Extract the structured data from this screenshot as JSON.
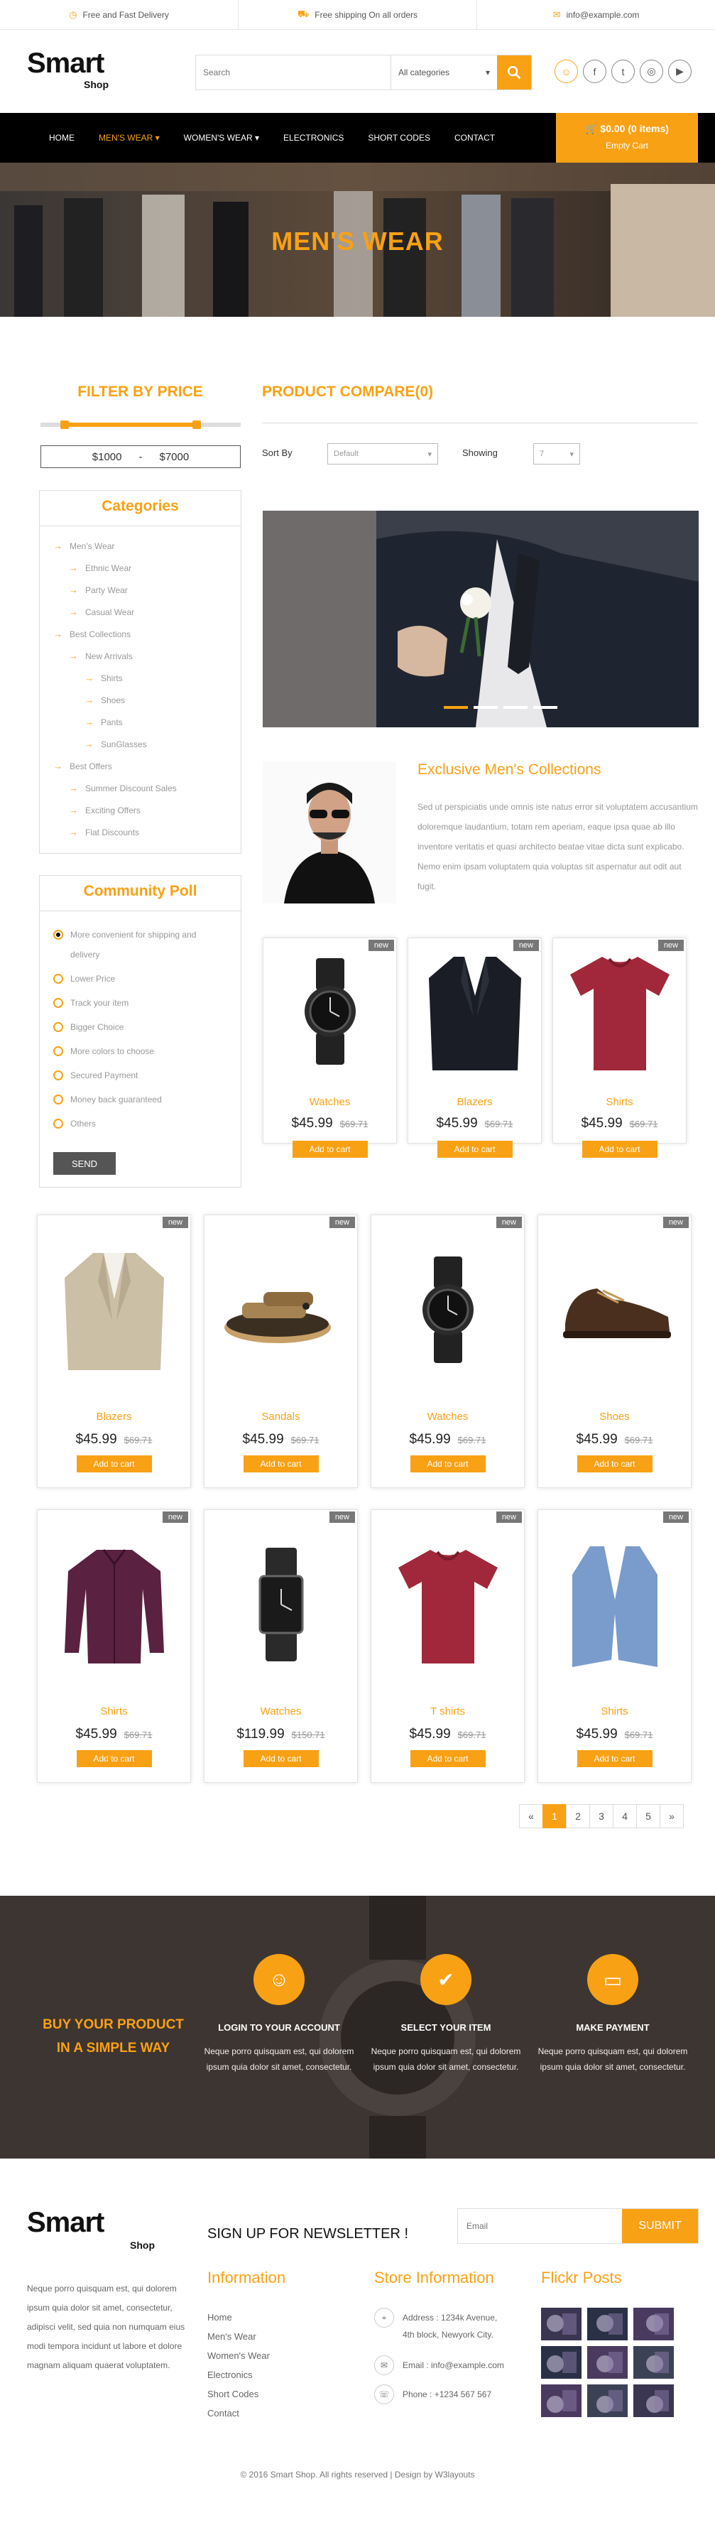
{
  "topbar": {
    "delivery": "Free and Fast Delivery",
    "shipping": "Free shipping On all orders",
    "email": "info@example.com"
  },
  "header": {
    "logo_main": "Smart",
    "logo_sub": "Shop",
    "search_placeholder": "Search",
    "category_select": "All categories"
  },
  "nav": {
    "items": [
      "HOME",
      "MEN'S WEAR",
      "WOMEN'S WEAR",
      "ELECTRONICS",
      "SHORT CODES",
      "CONTACT"
    ],
    "cart_total": "$0.00 (0 items)",
    "cart_label": "Empty Cart"
  },
  "banner": {
    "title": "MEN'S WEAR"
  },
  "filter": {
    "title": "FILTER BY PRICE",
    "min": "$1000",
    "sep": "-",
    "max": "$7000",
    "range_low_fraction": 0.12,
    "range_high_fraction": 0.78
  },
  "categories": {
    "title": "Categories",
    "items": [
      {
        "label": "Men's Wear",
        "level": 0
      },
      {
        "label": "Ethnic Wear",
        "level": 1
      },
      {
        "label": "Party Wear",
        "level": 1
      },
      {
        "label": "Casual Wear",
        "level": 1
      },
      {
        "label": "Best Collections",
        "level": 0
      },
      {
        "label": "New Arrivals",
        "level": 1
      },
      {
        "label": "Shirts",
        "level": 2
      },
      {
        "label": "Shoes",
        "level": 2
      },
      {
        "label": "Pants",
        "level": 2
      },
      {
        "label": "SunGlasses",
        "level": 2
      },
      {
        "label": "Best Offers",
        "level": 0
      },
      {
        "label": "Summer Discount Sales",
        "level": 1
      },
      {
        "label": "Exciting Offers",
        "level": 1
      },
      {
        "label": "Flat Discounts",
        "level": 1
      }
    ]
  },
  "poll": {
    "title": "Community Poll",
    "options": [
      {
        "line1": "More convenient for shipping and",
        "line2": "delivery",
        "selected": true
      },
      {
        "line1": "Lower Price"
      },
      {
        "line1": "Track your item"
      },
      {
        "line1": "Bigger Choice"
      },
      {
        "line1": "More colors to choose"
      },
      {
        "line1": "Secured Payment"
      },
      {
        "line1": "Money back guaranteed"
      },
      {
        "line1": "Others"
      }
    ],
    "send": "SEND"
  },
  "compare": {
    "title": "PRODUCT COMPARE(0)",
    "sort_label": "Sort By",
    "sort_value": "Default",
    "showing_label": "Showing",
    "showing_value": "7"
  },
  "exclusive": {
    "title": "Exclusive Men's Collections",
    "text": "Sed ut perspiciatis unde omnis iste natus error sit voluptatem accusantium doloremque laudantium, totam rem aperiam, eaque ipsa quae ab illo inventore veritatis et quasi architecto beatae vitae dicta sunt explicabo. Nemo enim ipsam voluptatem quia voluptas sit aspernatur aut odit aut fugit."
  },
  "products": [
    {
      "name": "Watches",
      "price": "$45.99",
      "old": "$69.71",
      "badge": "new",
      "btn": "Add to cart",
      "icon": "watch"
    },
    {
      "name": "Blazers",
      "price": "$45.99",
      "old": "$69.71",
      "badge": "new",
      "btn": "Add to cart",
      "icon": "blazer-dark"
    },
    {
      "name": "Shirts",
      "price": "$45.99",
      "old": "$69.71",
      "badge": "new",
      "btn": "Add to cart",
      "icon": "tshirt-red"
    },
    {
      "name": "Blazers",
      "price": "$45.99",
      "old": "$69.71",
      "badge": "new",
      "btn": "Add to cart",
      "icon": "blazer-beige"
    },
    {
      "name": "Sandals",
      "price": "$45.99",
      "old": "$69.71",
      "badge": "new",
      "btn": "Add to cart",
      "icon": "sandal"
    },
    {
      "name": "Watches",
      "price": "$45.99",
      "old": "$69.71",
      "badge": "new",
      "btn": "Add to cart",
      "icon": "watch"
    },
    {
      "name": "Shoes",
      "price": "$45.99",
      "old": "$69.71",
      "badge": "new",
      "btn": "Add to cart",
      "icon": "shoe"
    },
    {
      "name": "Shirts",
      "price": "$45.99",
      "old": "$69.71",
      "badge": "new",
      "btn": "Add to cart",
      "icon": "shirt-purple"
    },
    {
      "name": "Watches",
      "price": "$119.99",
      "old": "$150.71",
      "badge": "new",
      "btn": "Add to cart",
      "icon": "watch-square"
    },
    {
      "name": "T shirts",
      "price": "$45.99",
      "old": "$69.71",
      "badge": "new",
      "btn": "Add to cart",
      "icon": "tshirt-red"
    },
    {
      "name": "Shirts",
      "price": "$45.99",
      "old": "$69.71",
      "badge": "new",
      "btn": "Add to cart",
      "icon": "vest"
    }
  ],
  "pager": [
    "«",
    "1",
    "2",
    "3",
    "4",
    "5",
    "»"
  ],
  "steps": {
    "heading_line1": "BUY YOUR PRODUCT",
    "heading_line2": "IN A SIMPLE WAY",
    "items": [
      {
        "title": "LOGIN TO YOUR ACCOUNT",
        "text": "Neque porro quisquam est, qui dolorem ipsum quia dolor sit amet, consectetur.",
        "icon": "user-icon"
      },
      {
        "title": "SELECT YOUR ITEM",
        "text": "Neque porro quisquam est, qui dolorem ipsum quia dolor sit amet, consectetur.",
        "icon": "check-icon"
      },
      {
        "title": "MAKE PAYMENT",
        "text": "Neque porro quisquam est, qui dolorem ipsum quia dolor sit amet, consectetur.",
        "icon": "card-icon"
      }
    ]
  },
  "footer": {
    "logo_main": "Smart",
    "logo_sub": "Shop",
    "about": "Neque porro quisquam est, qui dolorem ipsum quia dolor sit amet, consectetur, adipisci velit, sed quia non numquam eius modi tempora incidunt ut labore et dolore magnam aliquam quaerat voluptatem.",
    "newsletter": "SIGN UP FOR NEWSLETTER !",
    "email_placeholder": "Email",
    "submit": "SUBMIT",
    "info_title": "Information",
    "info_links": [
      "Home",
      "Men's Wear",
      "Women's Wear",
      "Electronics",
      "Short Codes",
      "Contact"
    ],
    "store_title": "Store Information",
    "address_line1": "Address : 1234k Avenue,",
    "address_line2": "4th block, Newyork City.",
    "email": "Email : info@example.com",
    "phone": "Phone : +1234 567 567",
    "flickr_title": "Flickr Posts",
    "copyright": "© 2016 Smart Shop. All rights reserved | Design by W3layouts"
  },
  "colors": {
    "accent": "#f9a114",
    "nav": "#000000"
  }
}
